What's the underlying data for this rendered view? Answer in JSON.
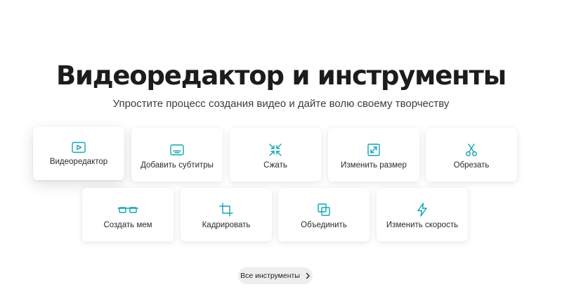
{
  "hero": {
    "title": "Видеоредактор и инструменты",
    "subtitle": "Упростите процесс создания видео и дайте волю своему творчеству"
  },
  "tools": [
    {
      "label": "Видеоредактор",
      "icon": "play-icon"
    },
    {
      "label": "Добавить субтитры",
      "icon": "subtitles-icon"
    },
    {
      "label": "Сжать",
      "icon": "compress-icon"
    },
    {
      "label": "Изменить размер",
      "icon": "resize-icon"
    },
    {
      "label": "Обрезать",
      "icon": "scissors-icon"
    },
    {
      "label": "Создать мем",
      "icon": "glasses-icon"
    },
    {
      "label": "Кадрировать",
      "icon": "crop-icon"
    },
    {
      "label": "Объединить",
      "icon": "merge-icon"
    },
    {
      "label": "Изменить скорость",
      "icon": "lightning-icon"
    }
  ],
  "all_tools": {
    "label": "Все инструменты"
  },
  "colors": {
    "accent": "#12a5b3",
    "text": "#1c1c1e",
    "button_bg": "#eeeef0"
  }
}
